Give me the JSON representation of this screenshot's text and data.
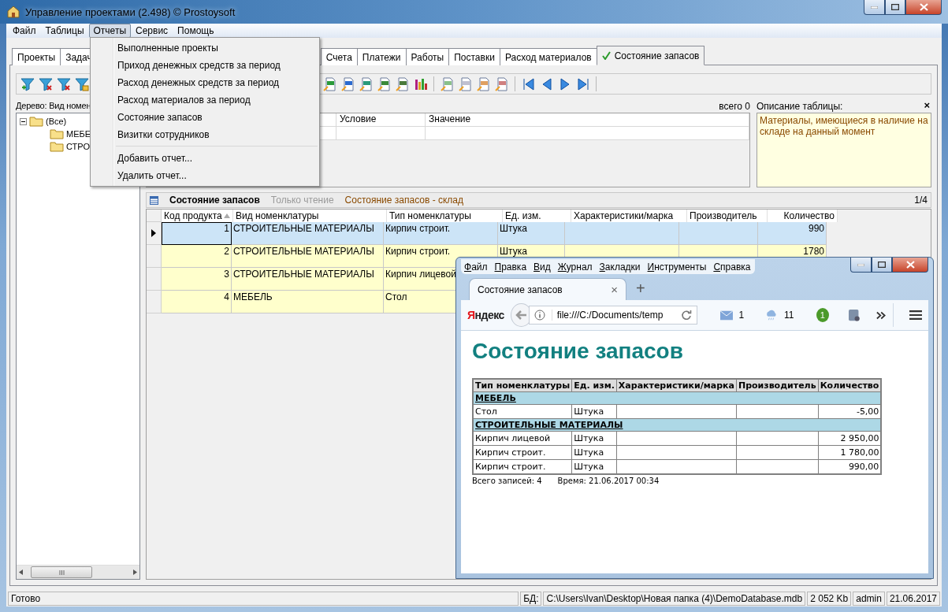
{
  "window": {
    "title": "Управление проектами (2.498) © Prostoysoft"
  },
  "menu_bar": [
    {
      "label": "Файл",
      "selected": false
    },
    {
      "label": "Таблицы",
      "selected": false
    },
    {
      "label": "Отчеты",
      "selected": true
    },
    {
      "label": "Сервис",
      "selected": false
    },
    {
      "label": "Помощь",
      "selected": false
    }
  ],
  "reports_menu": [
    {
      "kind": "item",
      "label": "Выполненные проекты"
    },
    {
      "kind": "item",
      "label": "Приход денежных средств за период"
    },
    {
      "kind": "item",
      "label": "Расход денежных средств за период"
    },
    {
      "kind": "item",
      "label": "Расход материалов за период"
    },
    {
      "kind": "item",
      "label": "Состояние запасов"
    },
    {
      "kind": "item",
      "label": "Визитки сотрудников"
    },
    {
      "kind": "separator"
    },
    {
      "kind": "item",
      "label": "Добавить отчет..."
    },
    {
      "kind": "item",
      "label": "Удалить отчет..."
    }
  ],
  "tabs": [
    {
      "label": "Проекты",
      "selected": false,
      "checked": false
    },
    {
      "label": "Задач",
      "selected": false,
      "checked": false
    },
    {
      "label": "Счета",
      "selected": false,
      "checked": false
    },
    {
      "label": "Платежи",
      "selected": false,
      "checked": false
    },
    {
      "label": "Работы",
      "selected": false,
      "checked": false
    },
    {
      "label": "Поставки",
      "selected": false,
      "checked": false
    },
    {
      "label": "Расход материалов",
      "selected": false,
      "checked": false
    },
    {
      "label": "Состояние запасов",
      "selected": true,
      "checked": true
    }
  ],
  "tree": {
    "caption": "Дерево: Вид номен",
    "root": {
      "label": "(Все)",
      "expanded": true,
      "children": [
        {
          "label": "МЕБЕ"
        },
        {
          "label": "СТРО"
        }
      ]
    }
  },
  "filter": {
    "count": "всего 0",
    "columns": [
      "Условие",
      "Значение"
    ]
  },
  "description": {
    "title": "Описание таблицы:",
    "close": "×",
    "text": "Материалы, имеющиеся в наличие на складе на данный момент"
  },
  "grid": {
    "title": "Состояние запасов",
    "mode": "Только чтение",
    "subtitle": "Состояние запасов - склад",
    "position": "1/4",
    "columns": [
      {
        "label": "Код продукта",
        "sorted": true
      },
      {
        "label": "Вид номенклатуры",
        "sorted": false
      },
      {
        "label": "Тип номенклатуры",
        "sorted": false
      },
      {
        "label": "Ед. изм.",
        "sorted": false
      },
      {
        "label": "Характеристики/марка",
        "sorted": false
      },
      {
        "label": "Производитель",
        "sorted": false
      },
      {
        "label": "Количество",
        "sorted": false
      }
    ],
    "rows": [
      {
        "selected": true,
        "code": "1",
        "kind": "СТРОИТЕЛЬНЫЕ МАТЕРИАЛЫ",
        "type": "Кирпич строит.",
        "unit": "Штука",
        "quantity": "990"
      },
      {
        "selected": false,
        "code": "2",
        "kind": "СТРОИТЕЛЬНЫЕ МАТЕРИАЛЫ",
        "type": "Кирпич строит.",
        "unit": "Штука",
        "quantity": "1780"
      },
      {
        "selected": false,
        "code": "3",
        "kind": "СТРОИТЕЛЬНЫЕ МАТЕРИАЛЫ",
        "type": "Кирпич лицевой"
      },
      {
        "selected": false,
        "code": "4",
        "kind": "МЕБЕЛЬ",
        "type": "Стол"
      }
    ]
  },
  "status_bar": {
    "status": "Готово",
    "db_label": "БД:",
    "db_path": "C:\\Users\\Ivan\\Desktop\\Новая папка (4)\\DemoDatabase.mdb",
    "size": "2 052 Kb",
    "user": "admin",
    "date": "21.06.2017"
  },
  "browser": {
    "menu": [
      "Файл",
      "Правка",
      "Вид",
      "Журнал",
      "Закладки",
      "Инструменты",
      "Справка"
    ],
    "tab": {
      "title": "Состояние запасов",
      "close": "×"
    },
    "new_tab": "+",
    "logo": "Яндекс",
    "url": "file:///C:/Documents/temp",
    "mail_count": "1",
    "weather": "11",
    "badge": "1",
    "page": {
      "heading": "Состояние запасов",
      "columns": [
        "Тип номенклатуры",
        "Ед. изм.",
        "Характеристики/марка",
        "Производитель",
        "Количество"
      ],
      "groups": [
        {
          "name": "МЕБЕЛЬ",
          "rows": [
            {
              "type": "Стол",
              "unit": "Штука",
              "quantity": "-5,00"
            }
          ]
        },
        {
          "name": "СТРОИТЕЛЬНЫЕ МАТЕРИАЛЫ",
          "rows": [
            {
              "type": "Кирпич лицевой",
              "unit": "Штука",
              "quantity": "2 950,00"
            },
            {
              "type": "Кирпич строит.",
              "unit": "Штука",
              "quantity": "1 780,00"
            },
            {
              "type": "Кирпич строит.",
              "unit": "Штука",
              "quantity": "990,00"
            }
          ]
        }
      ],
      "records": "Всего записей: 4",
      "time": "Время: 21.06.2017 00:34"
    }
  }
}
